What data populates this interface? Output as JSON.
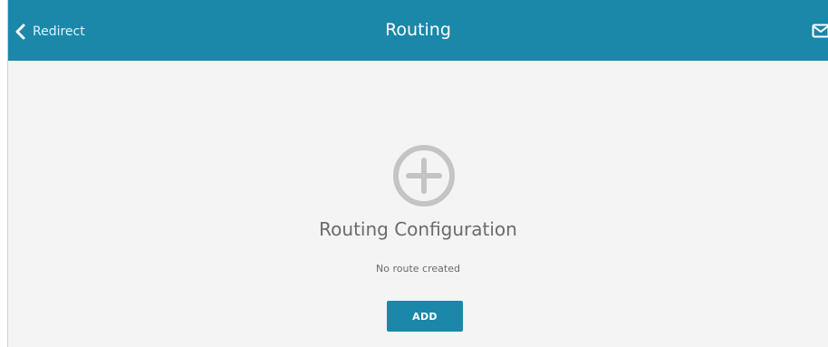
{
  "header": {
    "back_label": "Redirect",
    "title": "Routing",
    "icons": {
      "back": "chevron-left-icon",
      "mail": "mail-icon"
    }
  },
  "main": {
    "empty_icon": "plus-circle-icon",
    "section_title": "Routing Configuration",
    "status_text": "No route created",
    "add_label": "ADD"
  },
  "colors": {
    "accent": "#1b87a9",
    "background": "#f4f4f4",
    "text_muted": "#6b6b6b",
    "icon_muted": "#c4c4c4"
  }
}
